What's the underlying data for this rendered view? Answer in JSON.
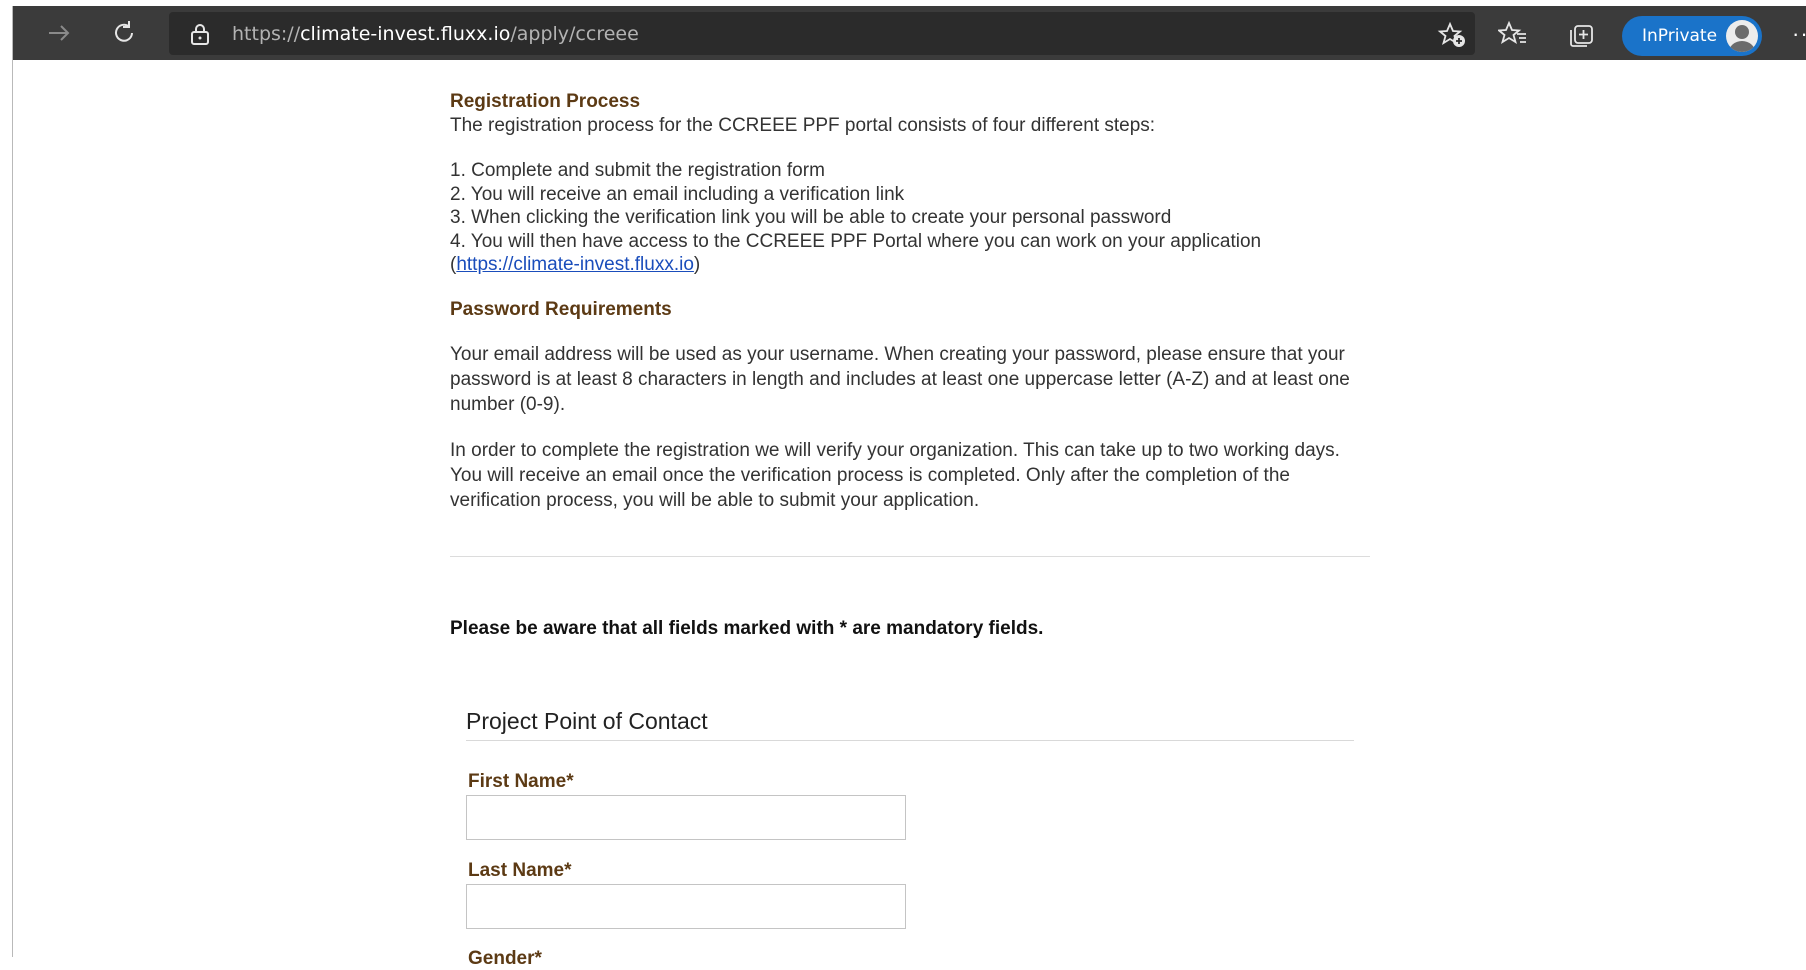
{
  "browser": {
    "url_scheme": "https://",
    "url_host": "climate-invest.fluxx.io",
    "url_path": "/apply/ccreee",
    "inprivate_label": "InPrivate",
    "more_label": "···",
    "accent_color": "#1a73c9"
  },
  "registration": {
    "heading": "Registration Process",
    "intro": "The registration process for the CCREEE PPF portal consists of four different steps:",
    "steps": [
      "1. Complete and submit the registration form",
      "2. You will receive an email including a verification link",
      "3. When clicking the verification link you will be able to create your personal password",
      "4. You will then have access to the CCREEE PPF Portal where you can work on your application"
    ],
    "link_open": "(",
    "link_text": "https://climate-invest.fluxx.io",
    "link_close": ")"
  },
  "password": {
    "heading": "Password Requirements",
    "para1": "Your email address will be used as your username. When creating your password, please ensure that your password is at least 8 characters in length and includes at least one uppercase letter (A-Z) and at least one number (0-9).",
    "para2": "In order to complete the registration we will verify your organization. This can take up to two working days. You will receive an email once the verification process is completed. Only after the completion of the verification process, you will be able to submit your application."
  },
  "form": {
    "mandatory_note": "Please be aware that all fields marked with * are mandatory fields.",
    "section_title": "Project Point of Contact",
    "first_name_label": "First Name*",
    "first_name_value": "",
    "last_name_label": "Last Name*",
    "last_name_value": "",
    "gender_label": "Gender*"
  }
}
